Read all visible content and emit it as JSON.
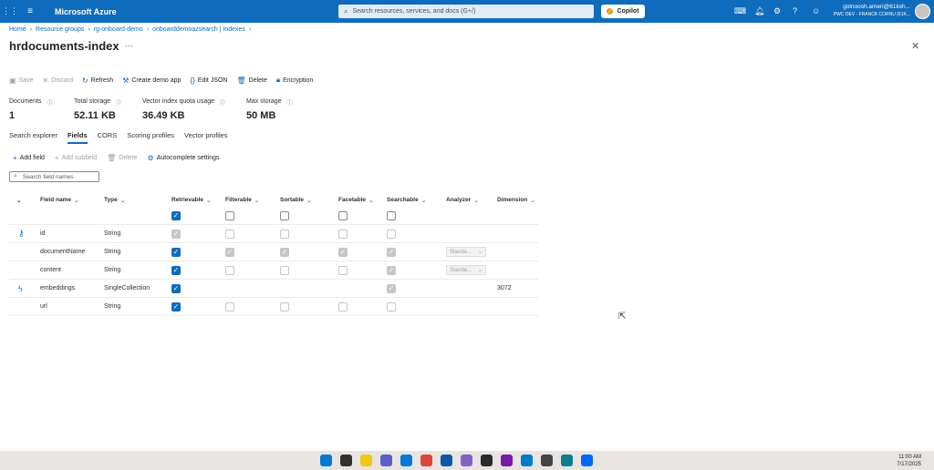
{
  "topbar": {
    "brand": "Microsoft Azure",
    "search_placeholder": "Search resources, services, and docs (G+/)",
    "copilot_label": "Copilot",
    "user_name": "golnoosh.ameri@61kxh...",
    "user_tenant": "PWC DEV - FRANCK CORNU (61K..."
  },
  "breadcrumb": [
    "Home",
    "Resource groups",
    "rg-onboard-demo",
    "onboarddemoazsearch | Indexes"
  ],
  "page": {
    "title": "hrdocuments-index",
    "more": "···"
  },
  "toolbar": {
    "save": "Save",
    "discard": "Discard",
    "refresh": "Refresh",
    "create_demo": "Create demo app",
    "edit_json": "Edit JSON",
    "delete": "Delete",
    "encryption": "Encryption"
  },
  "stats": [
    {
      "label": "Documents",
      "value": "1"
    },
    {
      "label": "Total storage",
      "value": "52.11 KB"
    },
    {
      "label": "Vector index quota usage",
      "value": "36.49 KB"
    },
    {
      "label": "Max storage",
      "value": "50 MB"
    }
  ],
  "tabs": [
    "Search explorer",
    "Fields",
    "CORS",
    "Scoring profiles",
    "Vector profiles"
  ],
  "active_tab": "Fields",
  "subtoolbar": {
    "add_field": "Add field",
    "add_subfield": "Add subfield",
    "delete": "Delete",
    "autocomplete": "Autocomplete settings"
  },
  "field_search_placeholder": "Search field names",
  "columns": [
    "Field name",
    "Type",
    "Retrievable",
    "Filterable",
    "Sortable",
    "Facetable",
    "Searchable",
    "Analyzer",
    "Dimension"
  ],
  "rows": [
    {
      "icon": "key-icon",
      "name": "id",
      "type": "String",
      "retrievable": "dison",
      "filterable": "dis",
      "sortable": "dis",
      "facetable": "dis",
      "searchable": "dis",
      "analyzer": "",
      "dimension": ""
    },
    {
      "icon": "",
      "name": "documentName",
      "type": "String",
      "retrievable": "on",
      "filterable": "dison",
      "sortable": "dison",
      "facetable": "dison",
      "searchable": "dison",
      "analyzer": "Standa...",
      "dimension": ""
    },
    {
      "icon": "",
      "name": "content",
      "type": "String",
      "retrievable": "on",
      "filterable": "dis",
      "sortable": "dis",
      "facetable": "dis",
      "searchable": "dison",
      "analyzer": "Standa...",
      "dimension": ""
    },
    {
      "icon": "vector-icon",
      "name": "embeddings",
      "type": "SingleCollection",
      "retrievable": "on",
      "filterable": "",
      "sortable": "",
      "facetable": "",
      "searchable": "dison",
      "analyzer": "",
      "dimension": "3072"
    },
    {
      "icon": "",
      "name": "url",
      "type": "String",
      "retrievable": "on",
      "filterable": "dis",
      "sortable": "dis",
      "facetable": "dis",
      "searchable": "dis",
      "analyzer": "",
      "dimension": ""
    }
  ],
  "taskbar": {
    "time": "11:00 AM",
    "date": "7/17/2025",
    "icons": [
      "windows-icon",
      "search-icon",
      "file-explorer-icon",
      "teams-icon",
      "outlook-icon",
      "chrome-icon",
      "edge-icon",
      "visual-studio-icon",
      "terminal-icon",
      "onenote-icon",
      "vscode-icon",
      "app-icon",
      "edge-dev-icon",
      "power-automate-icon"
    ]
  }
}
